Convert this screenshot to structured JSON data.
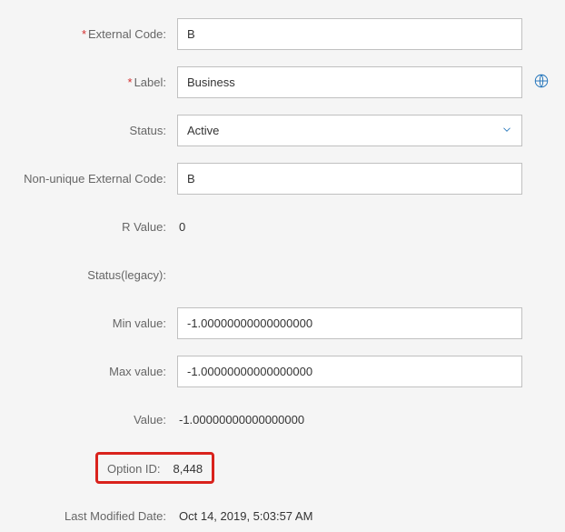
{
  "fields": {
    "external_code": {
      "label": "External Code:",
      "value": "B",
      "required": true
    },
    "label": {
      "label": "Label:",
      "value": "Business",
      "required": true
    },
    "status": {
      "label": "Status:",
      "value": "Active"
    },
    "non_unique_external_code": {
      "label": "Non-unique External Code:",
      "value": "B"
    },
    "r_value": {
      "label": "R Value:",
      "value": "0"
    },
    "status_legacy": {
      "label": "Status(legacy):",
      "value": ""
    },
    "min_value": {
      "label": "Min value:",
      "value": "-1.00000000000000000"
    },
    "max_value": {
      "label": "Max value:",
      "value": "-1.00000000000000000"
    },
    "value": {
      "label": "Value:",
      "value": "-1.00000000000000000"
    },
    "option_id": {
      "label": "Option ID:",
      "value": "8,448"
    },
    "last_modified_date": {
      "label": "Last Modified Date:",
      "value": "Oct 14, 2019, 5:03:57 AM"
    }
  }
}
